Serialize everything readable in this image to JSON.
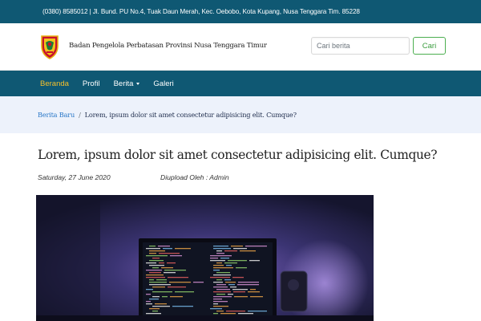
{
  "topbar": {
    "address": "(0380) 8585012 | Jl. Bund. PU No.4, Tuak Daun Merah, Kec. Oebobo, Kota Kupang, Nusa Tenggara Tim. 85228"
  },
  "header": {
    "org_name": "Badan Pengelola Perbatasan Provinsi Nusa Tenggara Timur",
    "search_placeholder": "Cari berita",
    "search_button": "Cari"
  },
  "nav": {
    "items": [
      {
        "label": "Beranda",
        "active": true
      },
      {
        "label": "Profil",
        "active": false
      },
      {
        "label": "Berita",
        "active": false,
        "dropdown": true
      },
      {
        "label": "Galeri",
        "active": false
      }
    ]
  },
  "breadcrumb": {
    "link": "Berita Baru",
    "separator": "/",
    "current": "Lorem, ipsum dolor sit amet consectetur adipisicing elit. Cumque?"
  },
  "article": {
    "title": "Lorem, ipsum dolor sit amet consectetur adipisicing elit. Cumque?",
    "date": "Saturday, 27 June 2020",
    "author": "Diupload Oleh : Admin",
    "image_icon": "desk-monitor-code-photo"
  },
  "colors": {
    "primary": "#0f5873",
    "active_nav": "#f5c02c",
    "button_green": "#4caf50",
    "breadcrumb_bg": "#edf2fb",
    "link": "#2a78c8"
  }
}
